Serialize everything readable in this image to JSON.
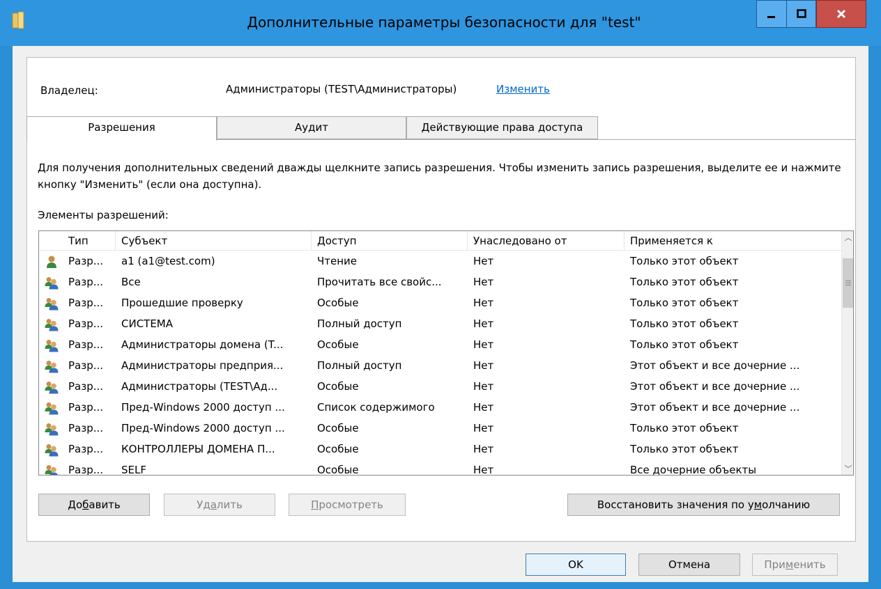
{
  "window": {
    "title": "Дополнительные параметры безопасности  для \"test\"",
    "icon": "folder-icon",
    "controls": {
      "minimize": "minimize-icon",
      "maximize": "maximize-icon",
      "close": "close-icon"
    }
  },
  "owner": {
    "label": "Владелец:",
    "value": "Администраторы (TEST\\Администраторы)",
    "change_link": "Изменить"
  },
  "tabs": [
    {
      "label": "Разрешения",
      "active": true
    },
    {
      "label": "Аудит",
      "active": false
    },
    {
      "label": "Действующие права доступа",
      "active": false
    }
  ],
  "description": "Для получения дополнительных сведений дважды щелкните запись разрешения. Чтобы изменить запись разрешения, выделите ее и нажмите кнопку \"Изменить\" (если она доступна).",
  "list_label": "Элементы разрешений:",
  "columns": [
    "Тип",
    "Субъект",
    "Доступ",
    "Унаследовано от",
    "Применяется к"
  ],
  "rows": [
    {
      "icon": "user-icon",
      "type": "Разр...",
      "subject": "a1 (a1@test.com)",
      "access": "Чтение",
      "inherited": "Нет",
      "applies": "Только этот объект"
    },
    {
      "icon": "group-icon",
      "type": "Разр...",
      "subject": "Все",
      "access": "Прочитать все свойс...",
      "inherited": "Нет",
      "applies": "Только этот объект"
    },
    {
      "icon": "group-icon",
      "type": "Разр...",
      "subject": "Прошедшие проверку",
      "access": "Особые",
      "inherited": "Нет",
      "applies": "Только этот объект"
    },
    {
      "icon": "group-icon",
      "type": "Разр...",
      "subject": "СИСТЕМА",
      "access": "Полный доступ",
      "inherited": "Нет",
      "applies": "Только этот объект"
    },
    {
      "icon": "group-icon",
      "type": "Разр...",
      "subject": "Администраторы домена (T...",
      "access": "Особые",
      "inherited": "Нет",
      "applies": "Только этот объект"
    },
    {
      "icon": "group-icon",
      "type": "Разр...",
      "subject": "Администраторы предприя...",
      "access": "Полный доступ",
      "inherited": "Нет",
      "applies": "Этот объект и все дочерние ..."
    },
    {
      "icon": "group-icon",
      "type": "Разр...",
      "subject": "Администраторы (TEST\\Ад...",
      "access": "Особые",
      "inherited": "Нет",
      "applies": "Этот объект и все дочерние ..."
    },
    {
      "icon": "group-icon",
      "type": "Разр...",
      "subject": "Пред-Windows 2000 доступ ...",
      "access": "Список содержимого",
      "inherited": "Нет",
      "applies": "Этот объект и все дочерние ..."
    },
    {
      "icon": "group-icon",
      "type": "Разр...",
      "subject": "Пред-Windows 2000 доступ ...",
      "access": "Особые",
      "inherited": "Нет",
      "applies": "Только этот объект"
    },
    {
      "icon": "group-icon",
      "type": "Разр...",
      "subject": "КОНТРОЛЛЕРЫ ДОМЕНА П...",
      "access": "Особые",
      "inherited": "Нет",
      "applies": "Только этот объект"
    },
    {
      "icon": "group-icon",
      "type": "Разр...",
      "subject": "SELF",
      "access": "Особые",
      "inherited": "Нет",
      "applies": "Все дочерние объекты"
    }
  ],
  "buttons": {
    "add": {
      "pre": "До",
      "acc": "б",
      "post": "авить"
    },
    "remove": {
      "pre": "Уд",
      "acc": "а",
      "post": "лить"
    },
    "view": {
      "pre": "",
      "acc": "П",
      "post": "росмотреть"
    },
    "restore": {
      "pre": "Восстановить значения по у",
      "acc": "м",
      "post": "олчанию"
    },
    "ok": "OK",
    "cancel": "Отмена",
    "apply": {
      "pre": "При",
      "acc": "м",
      "post": "енить"
    }
  }
}
